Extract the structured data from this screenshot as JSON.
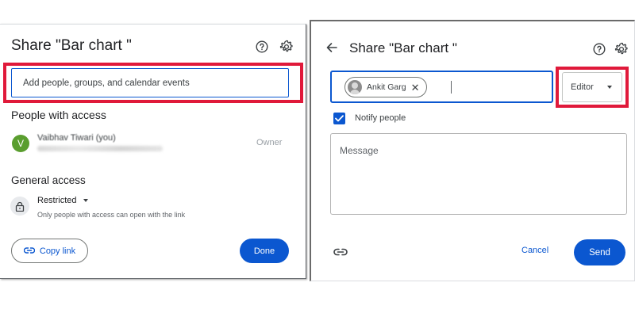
{
  "left_dialog": {
    "title": "Share \"Bar chart \"",
    "search": {
      "placeholder": "Add people, groups, and calendar events",
      "value": ""
    },
    "people_heading": "People with access",
    "person": {
      "avatar_letter": "V",
      "name": "Vaibhav Tiwari (you)",
      "role": "Owner"
    },
    "general_heading": "General access",
    "access": {
      "level": "Restricted",
      "description": "Only people with access can open with the link"
    },
    "copy_link_label": "Copy link",
    "done_label": "Done",
    "icons": {
      "help": "help-circle-icon",
      "settings": "gear-icon",
      "lock": "lock-icon",
      "link": "link-icon",
      "dropdown": "caret-down-icon"
    }
  },
  "right_dialog": {
    "title": "Share \"Bar chart \"",
    "recipient_chip": {
      "name": "Ankit Garg"
    },
    "role_select": {
      "selected": "Editor"
    },
    "notify": {
      "label": "Notify people",
      "checked": true
    },
    "message": {
      "placeholder": "Message",
      "value": ""
    },
    "cancel_label": "Cancel",
    "send_label": "Send",
    "icons": {
      "back": "arrow-left-icon",
      "help": "help-circle-icon",
      "settings": "gear-icon",
      "link": "link-icon",
      "remove": "close-icon",
      "dropdown": "caret-down-icon"
    }
  },
  "colors": {
    "accent": "#0b57d0",
    "highlight": "#e0193a",
    "avatar_green": "#5a9e2f"
  }
}
